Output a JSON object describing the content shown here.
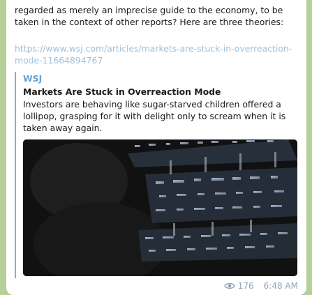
{
  "message": {
    "text": "regarded as merely an imprecise guide to the economy, to be taken in the context of other reports? Here are three theories:",
    "link": "https://www.wsj.com/articles/markets-are-stuck-in-overreaction-mode-11664894767"
  },
  "preview": {
    "site": "WSJ",
    "title": "Markets Are Stuck in Overreaction Mode",
    "description": "Investors are behaving like sugar-starved children offered a lollipop, grasping for it with delight only to scream when it is taken away again.",
    "image_alt": "trading-screens-photo"
  },
  "meta": {
    "views": "176",
    "time": "6:48 AM"
  },
  "colors": {
    "link": "#9fbfd8",
    "accent": "#6aa1d1",
    "background": "#b7cf98"
  }
}
